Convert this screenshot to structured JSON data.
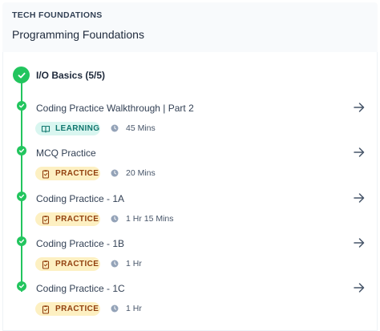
{
  "header": {
    "course_label": "TECH FOUNDATIONS",
    "course_title": "Programming Foundations"
  },
  "module": {
    "title": "I/O Basics (5/5)",
    "status": "completed"
  },
  "items": [
    {
      "title": "Coding Practice Walkthrough | Part 2",
      "type": "LEARNING",
      "type_icon": "book-icon",
      "duration": "45 Mins",
      "completed": true
    },
    {
      "title": "MCQ Practice",
      "type": "PRACTICE",
      "type_icon": "clipboard-icon",
      "duration": "20 Mins",
      "completed": true
    },
    {
      "title": "Coding Practice - 1A",
      "type": "PRACTICE",
      "type_icon": "clipboard-icon",
      "duration": "1 Hr 15 Mins",
      "completed": true
    },
    {
      "title": "Coding Practice - 1B",
      "type": "PRACTICE",
      "type_icon": "clipboard-icon",
      "duration": "1 Hr",
      "completed": true
    },
    {
      "title": "Coding Practice - 1C",
      "type": "PRACTICE",
      "type_icon": "clipboard-icon",
      "duration": "1 Hr",
      "completed": true
    }
  ],
  "colors": {
    "complete_green": "#22c55e",
    "learning_bg": "#d9f6f0",
    "learning_text": "#0f766e",
    "practice_bg": "#fdf0c2",
    "practice_text": "#92400e"
  }
}
